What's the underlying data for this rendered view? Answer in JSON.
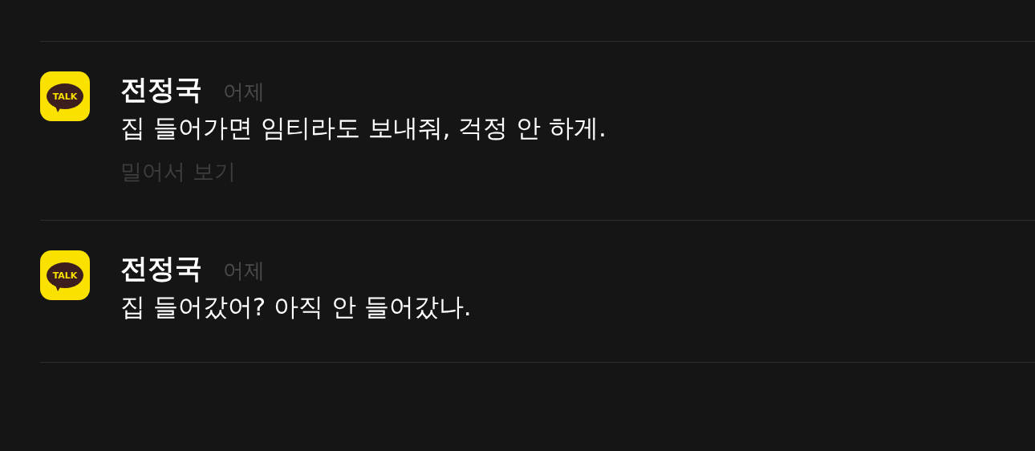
{
  "notifications": [
    {
      "app_icon_label": "TALK",
      "sender": "전정국",
      "time": "어제",
      "message": "집 들어가면 임티라도 보내줘, 걱정 안 하게.",
      "swipe_hint": "밀어서 보기"
    },
    {
      "app_icon_label": "TALK",
      "sender": "전정국",
      "time": "어제",
      "message": "집 들어갔어? 아직 안 들어갔나."
    }
  ]
}
